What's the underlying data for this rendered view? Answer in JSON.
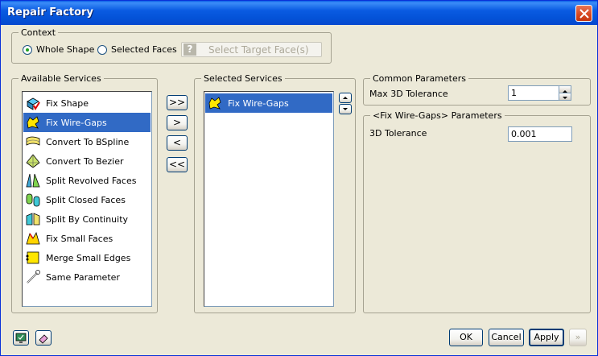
{
  "window": {
    "title": "Repair Factory"
  },
  "context": {
    "legend": "Context",
    "whole_shape_label": "Whole Shape",
    "selected_faces_label": "Selected Faces",
    "select_target_label": "Select Target Face(s)",
    "selected_option": "Whole Shape"
  },
  "available": {
    "legend": "Available Services",
    "items": [
      {
        "label": "Fix Shape",
        "icon": "fix-shape-icon"
      },
      {
        "label": "Fix Wire-Gaps",
        "icon": "fix-wire-gaps-icon",
        "selected": true
      },
      {
        "label": "Convert To BSpline",
        "icon": "convert-bspline-icon"
      },
      {
        "label": "Convert To Bezier",
        "icon": "convert-bezier-icon"
      },
      {
        "label": "Split Revolved Faces",
        "icon": "split-revolved-icon"
      },
      {
        "label": "Split Closed Faces",
        "icon": "split-closed-icon"
      },
      {
        "label": "Split By Continuity",
        "icon": "split-continuity-icon"
      },
      {
        "label": "Fix Small Faces",
        "icon": "fix-small-faces-icon"
      },
      {
        "label": "Merge Small Edges",
        "icon": "merge-edges-icon"
      },
      {
        "label": "Same Parameter",
        "icon": "same-parameter-icon"
      }
    ]
  },
  "transfer": {
    "add_all": ">>",
    "add": ">",
    "remove": "<",
    "remove_all": "<<"
  },
  "selected": {
    "legend": "Selected Services",
    "items": [
      {
        "label": "Fix Wire-Gaps",
        "icon": "fix-wire-gaps-icon",
        "selected": true
      }
    ]
  },
  "common": {
    "legend": "Common Parameters",
    "max_tol_label": "Max 3D Tolerance",
    "max_tol_value": "1"
  },
  "specific": {
    "legend": "<Fix Wire-Gaps> Parameters",
    "tol_label": "3D Tolerance",
    "tol_value": "0.001"
  },
  "footer": {
    "ok": "OK",
    "cancel": "Cancel",
    "apply": "Apply",
    "next": "»"
  },
  "colors": {
    "selection": "#316AC5",
    "titlebar": "#0A5BE2",
    "background": "#ECE9D8"
  }
}
